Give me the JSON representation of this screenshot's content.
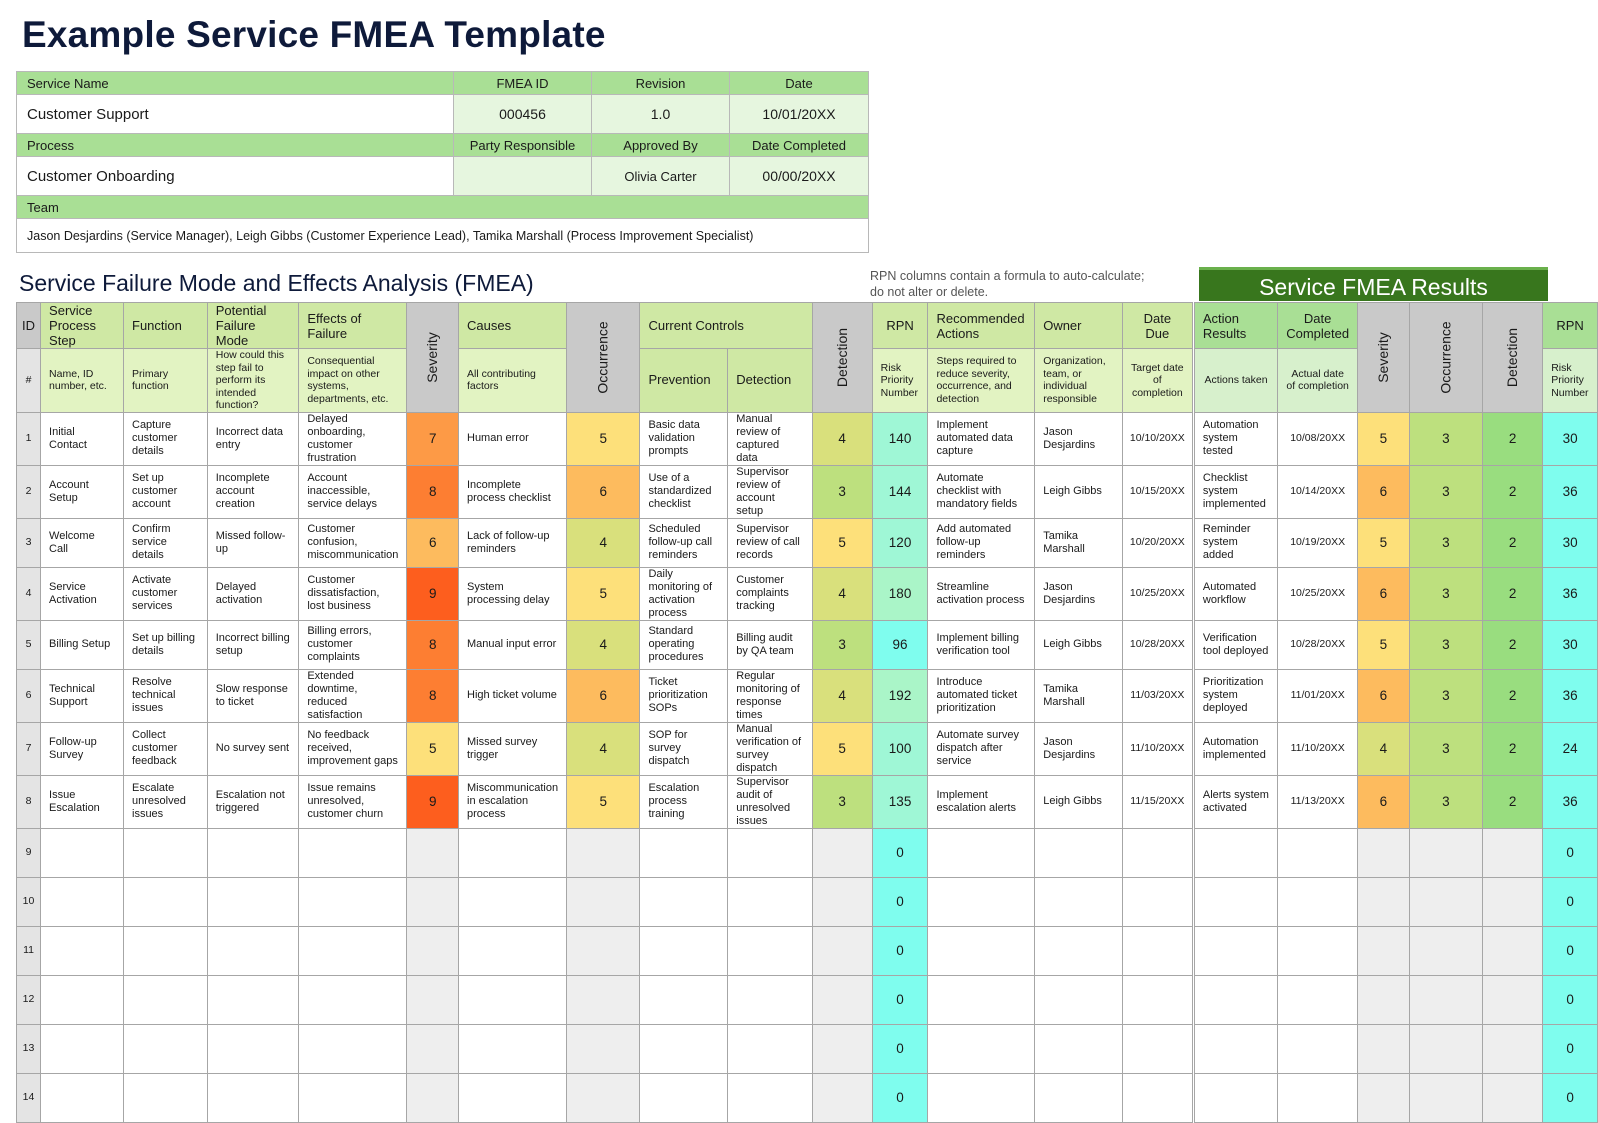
{
  "title": "Example Service FMEA Template",
  "info": {
    "service_name_label": "Service Name",
    "fmea_id_label": "FMEA ID",
    "revision_label": "Revision",
    "date_label": "Date",
    "service_name": "Customer Support",
    "fmea_id": "000456",
    "revision": "1.0",
    "date": "10/01/20XX",
    "process_label": "Process",
    "party_responsible_label": "Party Responsible",
    "approved_by_label": "Approved By",
    "date_completed_label": "Date Completed",
    "process": "Customer Onboarding",
    "party_responsible": "",
    "approved_by": "Olivia Carter",
    "date_completed": "00/00/20XX",
    "team_label": "Team",
    "team": "Jason Desjardins (Service Manager), Leigh Gibbs (Customer Experience Lead), Tamika Marshall (Process Improvement Specialist)"
  },
  "section_title": "Service Failure Mode and Effects Analysis (FMEA)",
  "note": [
    "RPN columns contain a formula to auto-calculate;",
    "do not alter or delete."
  ],
  "results_title": "Service FMEA Results",
  "headers": {
    "id": "ID",
    "id_sub": "#",
    "step": "Service Process Step",
    "step_sub": "Name, ID number, etc.",
    "function": "Function",
    "function_sub": "Primary function",
    "failure_mode": "Potential Failure Mode",
    "failure_mode_sub": "How could this step fail to perform its intended function?",
    "effects": "Effects of Failure",
    "effects_sub": "Consequential impact on other systems, departments, etc.",
    "severity": "Severity",
    "causes": "Causes",
    "causes_sub": "All contributing factors",
    "occurrence": "Occurrence",
    "current_controls": "Current Controls",
    "prevention": "Prevention",
    "detection_control": "Detection",
    "detection": "Detection",
    "rpn": "RPN",
    "rpn_sub": "Risk Priority Number",
    "recommended": "Recommended Actions",
    "recommended_sub": "Steps required to reduce severity, occurrence, and detection",
    "owner": "Owner",
    "owner_sub": "Organization, team, or individual responsible",
    "date_due": "Date Due",
    "date_due_sub": "Target date of completion",
    "action_results": "Action Results",
    "action_results_sub": "Actions taken",
    "date_completed": "Date Completed",
    "date_completed_sub": "Actual date of completion",
    "r_severity": "Severity",
    "r_occurrence": "Occurrence",
    "r_detection": "Detection",
    "r_rpn": "RPN",
    "r_rpn_sub": "Risk Priority Number"
  },
  "rows": [
    {
      "id": "1",
      "step": "Initial Contact",
      "function": "Capture customer details",
      "failure_mode": "Incorrect data entry",
      "effects": "Delayed onboarding, customer frustration",
      "severity": "7",
      "causes": "Human error",
      "occurrence": "5",
      "prevention": "Basic data validation prompts",
      "detection_control": "Manual review of captured data",
      "detection": "4",
      "rpn": "140",
      "recommended": "Implement automated data capture",
      "owner": "Jason Desjardins",
      "date_due": "10/10/20XX",
      "action_results": "Automation system tested",
      "date_completed": "10/08/20XX",
      "r_severity": "5",
      "r_occurrence": "3",
      "r_detection": "2",
      "r_rpn": "30"
    },
    {
      "id": "2",
      "step": "Account Setup",
      "function": "Set up customer account",
      "failure_mode": "Incomplete account creation",
      "effects": "Account inaccessible, service delays",
      "severity": "8",
      "causes": "Incomplete process checklist",
      "occurrence": "6",
      "prevention": "Use of a standardized checklist",
      "detection_control": "Supervisor review of account setup",
      "detection": "3",
      "rpn": "144",
      "recommended": "Automate checklist with mandatory fields",
      "owner": "Leigh Gibbs",
      "date_due": "10/15/20XX",
      "action_results": "Checklist system implemented",
      "date_completed": "10/14/20XX",
      "r_severity": "6",
      "r_occurrence": "3",
      "r_detection": "2",
      "r_rpn": "36"
    },
    {
      "id": "3",
      "step": "Welcome Call",
      "function": "Confirm service details",
      "failure_mode": "Missed follow-up",
      "effects": "Customer confusion, miscommunication",
      "severity": "6",
      "causes": "Lack of follow-up reminders",
      "occurrence": "4",
      "prevention": "Scheduled follow-up call reminders",
      "detection_control": "Supervisor review of call records",
      "detection": "5",
      "rpn": "120",
      "recommended": "Add automated follow-up reminders",
      "owner": "Tamika Marshall",
      "date_due": "10/20/20XX",
      "action_results": "Reminder system added",
      "date_completed": "10/19/20XX",
      "r_severity": "5",
      "r_occurrence": "3",
      "r_detection": "2",
      "r_rpn": "30"
    },
    {
      "id": "4",
      "step": "Service Activation",
      "function": "Activate customer services",
      "failure_mode": "Delayed activation",
      "effects": "Customer dissatisfaction, lost business",
      "severity": "9",
      "causes": "System processing delay",
      "occurrence": "5",
      "prevention": "Daily monitoring of activation process",
      "detection_control": "Customer complaints tracking",
      "detection": "4",
      "rpn": "180",
      "recommended": "Streamline activation process",
      "owner": "Jason Desjardins",
      "date_due": "10/25/20XX",
      "action_results": "Automated workflow",
      "date_completed": "10/25/20XX",
      "r_severity": "6",
      "r_occurrence": "3",
      "r_detection": "2",
      "r_rpn": "36"
    },
    {
      "id": "5",
      "step": "Billing Setup",
      "function": "Set up billing details",
      "failure_mode": "Incorrect billing setup",
      "effects": "Billing errors, customer complaints",
      "severity": "8",
      "causes": "Manual input error",
      "occurrence": "4",
      "prevention": "Standard operating procedures",
      "detection_control": "Billing audit by QA team",
      "detection": "3",
      "rpn": "96",
      "recommended": "Implement billing verification tool",
      "owner": "Leigh Gibbs",
      "date_due": "10/28/20XX",
      "action_results": "Verification tool deployed",
      "date_completed": "10/28/20XX",
      "r_severity": "5",
      "r_occurrence": "3",
      "r_detection": "2",
      "r_rpn": "30"
    },
    {
      "id": "6",
      "step": "Technical Support",
      "function": "Resolve technical issues",
      "failure_mode": "Slow response to ticket",
      "effects": "Extended downtime, reduced satisfaction",
      "severity": "8",
      "causes": "High ticket volume",
      "occurrence": "6",
      "prevention": "Ticket prioritization SOPs",
      "detection_control": "Regular monitoring of response times",
      "detection": "4",
      "rpn": "192",
      "recommended": "Introduce automated ticket prioritization",
      "owner": "Tamika Marshall",
      "date_due": "11/03/20XX",
      "action_results": "Prioritization system deployed",
      "date_completed": "11/01/20XX",
      "r_severity": "6",
      "r_occurrence": "3",
      "r_detection": "2",
      "r_rpn": "36"
    },
    {
      "id": "7",
      "step": "Follow-up Survey",
      "function": "Collect customer feedback",
      "failure_mode": "No survey sent",
      "effects": "No feedback received, improvement gaps",
      "severity": "5",
      "causes": "Missed survey trigger",
      "occurrence": "4",
      "prevention": "SOP for survey dispatch",
      "detection_control": "Manual verification of survey dispatch",
      "detection": "5",
      "rpn": "100",
      "recommended": "Automate survey dispatch after service",
      "owner": "Jason Desjardins",
      "date_due": "11/10/20XX",
      "action_results": "Automation implemented",
      "date_completed": "11/10/20XX",
      "r_severity": "4",
      "r_occurrence": "3",
      "r_detection": "2",
      "r_rpn": "24"
    },
    {
      "id": "8",
      "step": "Issue Escalation",
      "function": "Escalate unresolved issues",
      "failure_mode": "Escalation not triggered",
      "effects": "Issue remains unresolved, customer churn",
      "severity": "9",
      "causes": "Miscommunication in escalation process",
      "occurrence": "5",
      "prevention": "Escalation process training",
      "detection_control": "Supervisor audit of unresolved issues",
      "detection": "3",
      "rpn": "135",
      "recommended": "Implement escalation alerts",
      "owner": "Leigh Gibbs",
      "date_due": "11/15/20XX",
      "action_results": "Alerts system activated",
      "date_completed": "11/13/20XX",
      "r_severity": "6",
      "r_occurrence": "3",
      "r_detection": "2",
      "r_rpn": "36"
    },
    {
      "id": "9",
      "step": "",
      "function": "",
      "failure_mode": "",
      "effects": "",
      "severity": "",
      "causes": "",
      "occurrence": "",
      "prevention": "",
      "detection_control": "",
      "detection": "",
      "rpn": "0",
      "recommended": "",
      "owner": "",
      "date_due": "",
      "action_results": "",
      "date_completed": "",
      "r_severity": "",
      "r_occurrence": "",
      "r_detection": "",
      "r_rpn": "0"
    },
    {
      "id": "10",
      "step": "",
      "function": "",
      "failure_mode": "",
      "effects": "",
      "severity": "",
      "causes": "",
      "occurrence": "",
      "prevention": "",
      "detection_control": "",
      "detection": "",
      "rpn": "0",
      "recommended": "",
      "owner": "",
      "date_due": "",
      "action_results": "",
      "date_completed": "",
      "r_severity": "",
      "r_occurrence": "",
      "r_detection": "",
      "r_rpn": "0"
    },
    {
      "id": "11",
      "step": "",
      "function": "",
      "failure_mode": "",
      "effects": "",
      "severity": "",
      "causes": "",
      "occurrence": "",
      "prevention": "",
      "detection_control": "",
      "detection": "",
      "rpn": "0",
      "recommended": "",
      "owner": "",
      "date_due": "",
      "action_results": "",
      "date_completed": "",
      "r_severity": "",
      "r_occurrence": "",
      "r_detection": "",
      "r_rpn": "0"
    },
    {
      "id": "12",
      "step": "",
      "function": "",
      "failure_mode": "",
      "effects": "",
      "severity": "",
      "causes": "",
      "occurrence": "",
      "prevention": "",
      "detection_control": "",
      "detection": "",
      "rpn": "0",
      "recommended": "",
      "owner": "",
      "date_due": "",
      "action_results": "",
      "date_completed": "",
      "r_severity": "",
      "r_occurrence": "",
      "r_detection": "",
      "r_rpn": "0"
    },
    {
      "id": "13",
      "step": "",
      "function": "",
      "failure_mode": "",
      "effects": "",
      "severity": "",
      "causes": "",
      "occurrence": "",
      "prevention": "",
      "detection_control": "",
      "detection": "",
      "rpn": "0",
      "recommended": "",
      "owner": "",
      "date_due": "",
      "action_results": "",
      "date_completed": "",
      "r_severity": "",
      "r_occurrence": "",
      "r_detection": "",
      "r_rpn": "0"
    },
    {
      "id": "14",
      "step": "",
      "function": "",
      "failure_mode": "",
      "effects": "",
      "severity": "",
      "causes": "",
      "occurrence": "",
      "prevention": "",
      "detection_control": "",
      "detection": "",
      "rpn": "0",
      "recommended": "",
      "owner": "",
      "date_due": "",
      "action_results": "",
      "date_completed": "",
      "r_severity": "",
      "r_occurrence": "",
      "r_detection": "",
      "r_rpn": "0"
    }
  ],
  "colors": {
    "score_scale": {
      "2": "#99dd7f",
      "3": "#bde07e",
      "4": "#d9e07c",
      "5": "#fde07a",
      "6": "#fdbb5e",
      "7": "#fd9a46",
      "8": "#fd7e32",
      "9": "#fd5e1e"
    },
    "rpn_scale": {
      "low": "#7ffdee",
      "high": "#a9f5c9"
    },
    "header_green": "#cfe8a4",
    "results_dark_green": "#38761d"
  }
}
